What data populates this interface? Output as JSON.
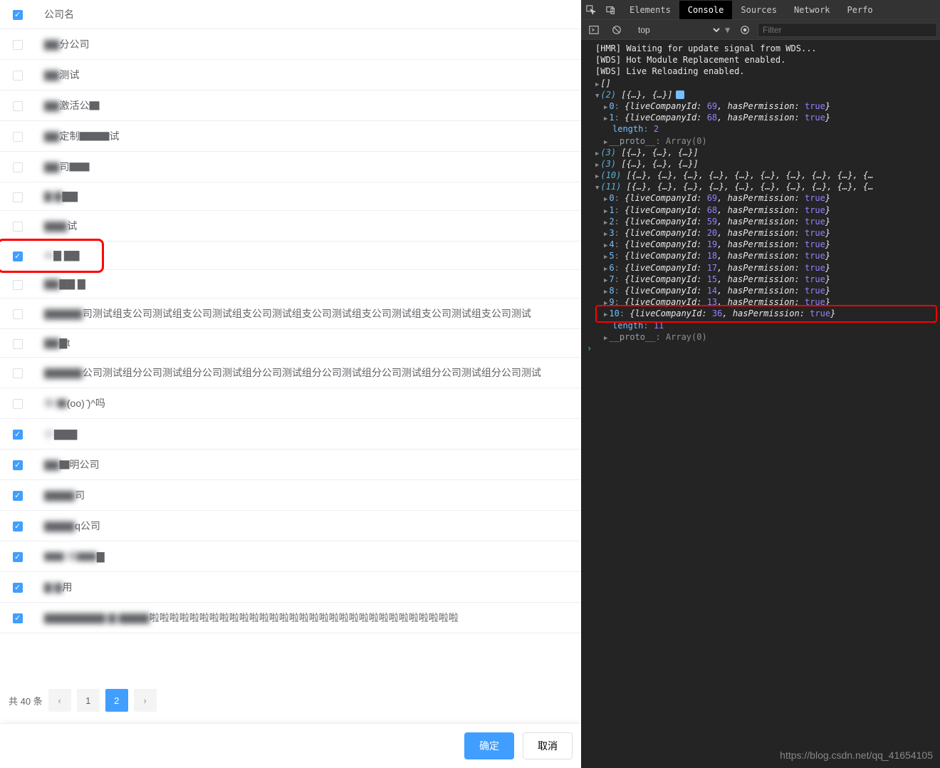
{
  "table": {
    "header": "公司名",
    "rows": [
      {
        "checked": false,
        "text_a": "▇▇",
        "text_b": "分公司"
      },
      {
        "checked": false,
        "text_a": "▇▇",
        "text_b": "测试"
      },
      {
        "checked": false,
        "text_a": "▇▇",
        "text_b": "激活公▇"
      },
      {
        "checked": false,
        "text_a": "▇▇",
        "text_b": "定制▇▇▇试"
      },
      {
        "checked": false,
        "text_a": "▇▇",
        "text_b": "司▇▇"
      },
      {
        "checked": false,
        "text_a": "▇ ▇",
        "text_b": "▇▇"
      },
      {
        "checked": false,
        "text_a": "▇▇▇",
        "text_b": "试"
      },
      {
        "checked": true,
        "text_a": "AI",
        "text_b": "▇ ▇▇",
        "highlight": true
      },
      {
        "checked": false,
        "text_a": "▇▇",
        "text_b": "▇▇ ▇"
      },
      {
        "checked": false,
        "text_a": "▇▇▇▇▇",
        "text_b": "司测试组支公司测试组支公司测试组支公司测试组支公司测试组支公司测试组支公司测试组支公司测试"
      },
      {
        "checked": false,
        "text_a": "▇▇",
        "text_b": "▇t"
      },
      {
        "checked": false,
        "text_a": "▇▇▇▇▇",
        "text_b": "公司测试组分公司测试组分公司测试组分公司测试组分公司测试组分公司测试组分公司测试组分公司测试"
      },
      {
        "checked": false,
        "text_a": "俆 ▇",
        "text_b": "(oo) ̄)^吗"
      },
      {
        "checked": true,
        "text_a": "小",
        "text_b": "▇▇▇"
      },
      {
        "checked": true,
        "text_a": "▇▇",
        "text_b": "▇明公司"
      },
      {
        "checked": true,
        "text_a": "▇▇▇▇",
        "text_b": "司"
      },
      {
        "checked": true,
        "text_a": "▇▇▇▇",
        "text_b": "q公司"
      },
      {
        "checked": true,
        "text_a": "▇▇ 保▇▇",
        "text_b": "▇"
      },
      {
        "checked": true,
        "text_a": "▇ ▇",
        "text_b": "用"
      },
      {
        "checked": true,
        "text_a": "▇▇▇▇▇▇▇▇ ▇ ▇▇▇▇",
        "text_b": "啦啦啦啦啦啦啦啦啦啦啦啦啦啦啦啦啦啦啦啦啦啦啦啦啦啦啦啦啦啦啦"
      }
    ]
  },
  "pagination": {
    "total_label": "共 40 条",
    "prev": "‹",
    "next": "›",
    "pages": [
      "1",
      "2"
    ],
    "active": 2
  },
  "footer": {
    "ok": "确定",
    "cancel": "取消"
  },
  "devtools": {
    "tabs": [
      "Elements",
      "Console",
      "Sources",
      "Network",
      "Perfo"
    ],
    "active_tab": "Console",
    "context": "top",
    "filter_placeholder": "Filter",
    "messages": {
      "hmr": "[HMR] Waiting for update signal from WDS...",
      "wds1": "[WDS] Hot Module Replacement enabled.",
      "wds2": "[WDS] Live Reloading enabled."
    },
    "log_arrays": [
      {
        "count": "(2)",
        "preview": "[{…}, {…}]",
        "expanded": true,
        "hasBadge": true,
        "items": [
          {
            "idx": "0",
            "id": 69,
            "perm": "true"
          },
          {
            "idx": "1",
            "id": 68,
            "perm": "true"
          }
        ],
        "length": 2,
        "proto": "Array(0)"
      },
      {
        "count": "(3)",
        "preview": "[{…}, {…}, {…}]",
        "expanded": false
      },
      {
        "count": "(3)",
        "preview": "[{…}, {…}, {…}]",
        "expanded": false
      },
      {
        "count": "(10)",
        "preview": "[{…}, {…}, {…}, {…}, {…}, {…}, {…}, {…}, {…}, {…",
        "expanded": false
      },
      {
        "count": "(11)",
        "preview": "[{…}, {…}, {…}, {…}, {…}, {…}, {…}, {…}, {…}, {…",
        "expanded": true,
        "items": [
          {
            "idx": "0",
            "id": 69,
            "perm": "true"
          },
          {
            "idx": "1",
            "id": 68,
            "perm": "true"
          },
          {
            "idx": "2",
            "id": 59,
            "perm": "true"
          },
          {
            "idx": "3",
            "id": 20,
            "perm": "true"
          },
          {
            "idx": "4",
            "id": 19,
            "perm": "true"
          },
          {
            "idx": "5",
            "id": 18,
            "perm": "true"
          },
          {
            "idx": "6",
            "id": 17,
            "perm": "true"
          },
          {
            "idx": "7",
            "id": 15,
            "perm": "true"
          },
          {
            "idx": "8",
            "id": 14,
            "perm": "true"
          },
          {
            "idx": "9",
            "id": 13,
            "perm": "true"
          },
          {
            "idx": "10",
            "id": 36,
            "perm": "true",
            "highlight": true
          }
        ],
        "length": 11,
        "proto": "Array(0)"
      }
    ],
    "obj_key1": "liveCompanyId",
    "obj_key2": "hasPermission",
    "length_label": "length",
    "proto_label": "__proto__",
    "empty_array": "[]"
  },
  "watermark": "https://blog.csdn.net/qq_41654105"
}
